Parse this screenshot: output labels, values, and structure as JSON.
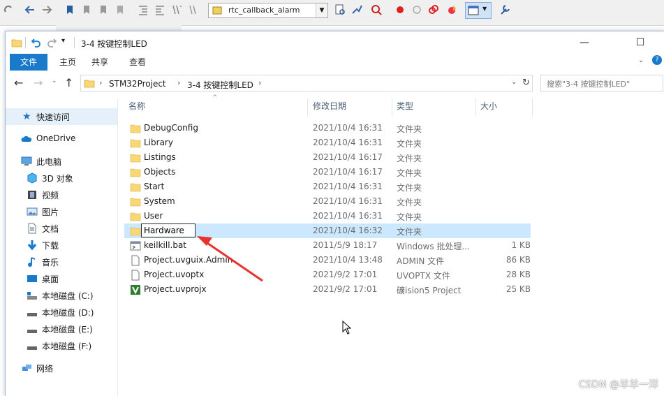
{
  "ide": {
    "combo_value": "rtc_callback_alarm"
  },
  "window": {
    "title": "3-4 按键控制LED",
    "ribbon_tabs": [
      "文件",
      "主页",
      "共享",
      "查看"
    ],
    "breadcrumb": [
      "STM32Project",
      "3-4 按键控制LED"
    ],
    "search_placeholder": "搜索\"3-4 按键控制LED\""
  },
  "nav": {
    "quick_access": "快速访问",
    "onedrive": "OneDrive",
    "this_pc": "此电脑",
    "items": [
      "3D 对象",
      "视频",
      "图片",
      "文档",
      "下载",
      "音乐",
      "桌面",
      "本地磁盘 (C:)",
      "本地磁盘 (D:)",
      "本地磁盘 (E:)",
      "本地磁盘 (F:)"
    ],
    "network": "网络"
  },
  "columns": {
    "name": "名称",
    "date": "修改日期",
    "type": "类型",
    "size": "大小"
  },
  "files": [
    {
      "name": "DebugConfig",
      "date": "2021/10/4 16:31",
      "type": "文件夹",
      "size": "",
      "icon": "folder-icon"
    },
    {
      "name": "Library",
      "date": "2021/10/4 16:31",
      "type": "文件夹",
      "size": "",
      "icon": "folder-icon"
    },
    {
      "name": "Listings",
      "date": "2021/10/4 16:17",
      "type": "文件夹",
      "size": "",
      "icon": "folder-icon"
    },
    {
      "name": "Objects",
      "date": "2021/10/4 16:17",
      "type": "文件夹",
      "size": "",
      "icon": "folder-icon"
    },
    {
      "name": "Start",
      "date": "2021/10/4 16:31",
      "type": "文件夹",
      "size": "",
      "icon": "folder-icon"
    },
    {
      "name": "System",
      "date": "2021/10/4 16:31",
      "type": "文件夹",
      "size": "",
      "icon": "folder-icon"
    },
    {
      "name": "User",
      "date": "2021/10/4 16:31",
      "type": "文件夹",
      "size": "",
      "icon": "folder-icon"
    },
    {
      "name": "Hardware",
      "date": "2021/10/4 16:32",
      "type": "文件夹",
      "size": "",
      "icon": "folder-icon"
    },
    {
      "name": "keilkill.bat",
      "date": "2011/5/9 18:17",
      "type": "Windows 批处理...",
      "size": "1 KB",
      "icon": "batch-file-icon"
    },
    {
      "name": "Project.uvguix.Admin",
      "date": "2021/10/4 13:48",
      "type": "ADMIN 文件",
      "size": "86 KB",
      "icon": "file-icon"
    },
    {
      "name": "Project.uvoptx",
      "date": "2021/9/2 17:01",
      "type": "UVOPTX 文件",
      "size": "28 KB",
      "icon": "file-icon"
    },
    {
      "name": "Project.uvprojx",
      "date": "2021/9/2 17:01",
      "type": "礦ision5 Project",
      "size": "25 KB",
      "icon": "keil-project-icon"
    }
  ],
  "watermark": "CSDN @羊羊一洋",
  "colors": {
    "accent": "#1979ca",
    "selection": "#cce8ff",
    "folder": "#f8d775",
    "arrow": "#e8322c"
  }
}
